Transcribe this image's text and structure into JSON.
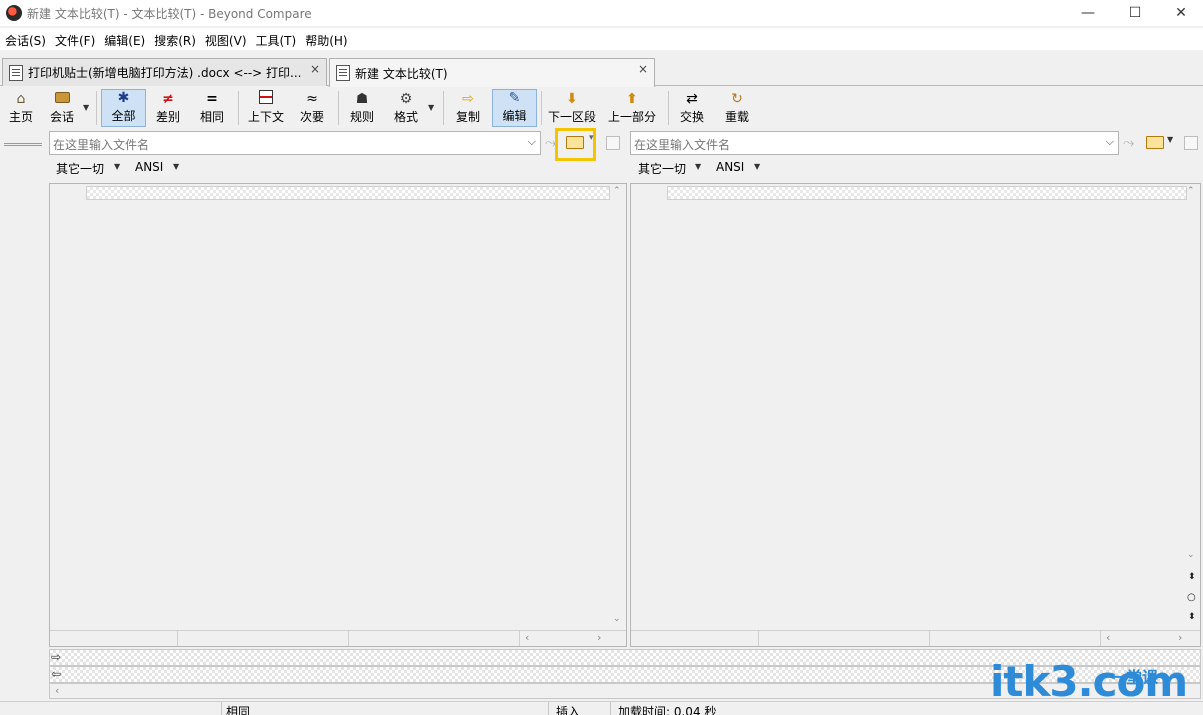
{
  "window": {
    "title": "新建 文本比较(T) - 文本比较(T) - Beyond Compare",
    "controls": {
      "minimize": "—",
      "maximize": "☐",
      "close": "✕"
    }
  },
  "menu": [
    "会话(S)",
    "文件(F)",
    "编辑(E)",
    "搜索(R)",
    "视图(V)",
    "工具(T)",
    "帮助(H)"
  ],
  "tabs": [
    {
      "label": "打印机贴士(新增电脑打印方法) .docx <--> 打印...",
      "close": "×"
    },
    {
      "label": "新建 文本比较(T)",
      "close": "×"
    }
  ],
  "toolbar": {
    "home": "主页",
    "session": "会话",
    "all": "全部",
    "diffs": "差别",
    "same": "相同",
    "context": "上下文",
    "minor": "次要",
    "rules": "规则",
    "format": "格式",
    "copy": "复制",
    "edit": "编辑",
    "next_section": "下一区段",
    "prev_section": "上一部分",
    "swap": "交换",
    "reload": "重载"
  },
  "left": {
    "path_placeholder": "在这里输入文件名",
    "format_label": "其它一切",
    "encoding": "ANSI"
  },
  "right": {
    "path_placeholder": "在这里输入文件名",
    "format_label": "其它一切",
    "encoding": "ANSI"
  },
  "statusbar": {
    "same": "相同",
    "insert": "插入",
    "load_time": "加载时间:  0.04 秒"
  },
  "watermark": {
    "main": "itk3.com",
    "sub": "一堂课"
  },
  "colors": {
    "highlight": "#f5c400",
    "selected_bg": "#cfe2f5",
    "watermark": "#2d8bd8"
  }
}
